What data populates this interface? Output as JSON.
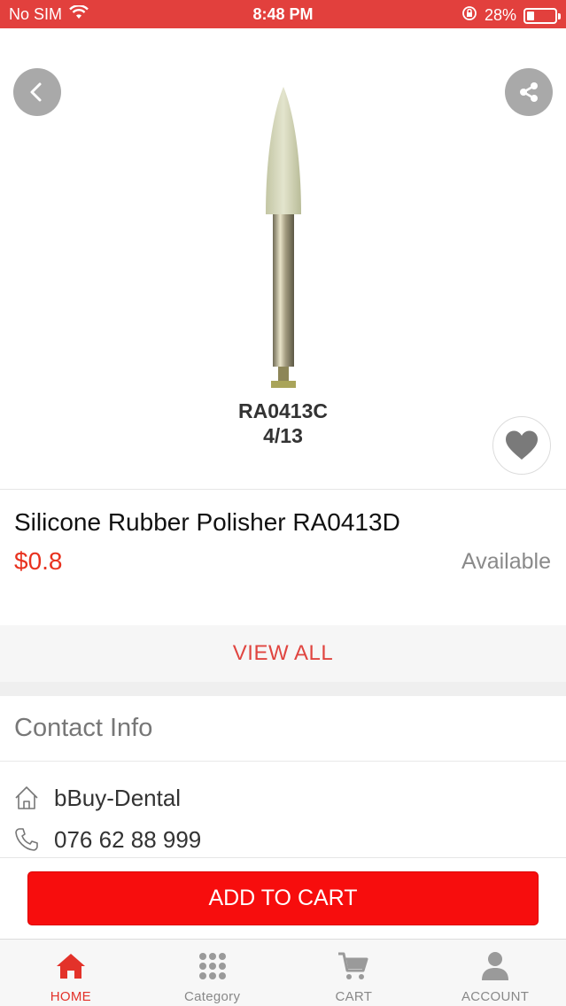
{
  "status_bar": {
    "carrier": "No SIM",
    "time": "8:48 PM",
    "battery": "28%",
    "battery_level": 0.28
  },
  "product": {
    "image_caption_line1": "RA0413C",
    "image_caption_line2": "4/13",
    "title": "Silicone Rubber Polisher RA0413D",
    "price": "$0.8",
    "availability": "Available",
    "view_all_label": "VIEW ALL"
  },
  "contact": {
    "heading": "Contact Info",
    "name": "bBuy-Dental",
    "phone": "076 62 88 999"
  },
  "cart": {
    "add_label": "ADD TO CART"
  },
  "nav": {
    "items": [
      {
        "label": "HOME",
        "icon": "home-icon",
        "active": true
      },
      {
        "label": "Category",
        "icon": "grid-icon",
        "active": false
      },
      {
        "label": "CART",
        "icon": "cart-icon",
        "active": false
      },
      {
        "label": "ACCOUNT",
        "icon": "user-icon",
        "active": false
      }
    ]
  },
  "colors": {
    "status_bar": "#e2403d",
    "accent": "#e8321f",
    "add_to_cart": "#f70d0d"
  }
}
